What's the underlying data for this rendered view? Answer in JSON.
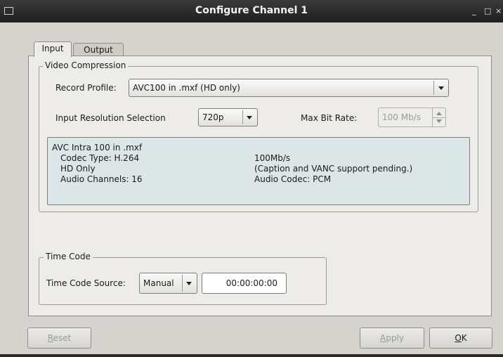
{
  "window": {
    "title": "Configure Channel 1",
    "controls": {
      "minimize": "_",
      "maximize": "□",
      "close": "×"
    }
  },
  "tabs": [
    {
      "label": "Input",
      "active": true
    },
    {
      "label": "Output",
      "active": false
    }
  ],
  "video_compression": {
    "legend": "Video Compression",
    "record_profile_label": "Record Profile:",
    "record_profile_value": "AVC100 in .mxf  (HD only)",
    "input_resolution_label": "Input Resolution Selection",
    "input_resolution_value": "720p",
    "max_bit_rate_label": "Max Bit Rate:",
    "max_bit_rate_value": "100 Mb/s",
    "info": {
      "title": "AVC Intra 100 in .mxf",
      "left": [
        "Codec Type: H.264",
        "HD Only",
        "Audio Channels: 16"
      ],
      "right": [
        "100Mb/s",
        "(Caption and VANC support pending.)",
        "Audio Codec: PCM"
      ]
    }
  },
  "time_code": {
    "legend": "Time Code",
    "source_label": "Time Code Source:",
    "source_value": "Manual",
    "timecode_value": "00:00:00:00"
  },
  "buttons": {
    "reset": {
      "mnemonic": "R",
      "rest": "eset"
    },
    "apply": {
      "mnemonic": "A",
      "rest": "pply"
    },
    "ok": {
      "mnemonic": "O",
      "rest": "K"
    }
  }
}
